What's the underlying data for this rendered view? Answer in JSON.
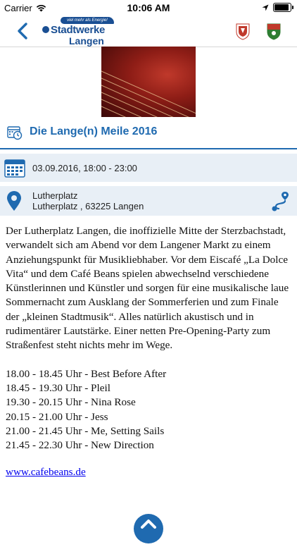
{
  "status_bar": {
    "carrier": "Carrier",
    "time": "10:06 AM"
  },
  "nav": {
    "logo_tagline": "viel mehr als Energie!",
    "logo_line1": "Stadtwerke",
    "logo_line2": "Langen"
  },
  "event": {
    "title": "Die Lange(n) Meile 2016",
    "datetime": "03.09.2016, 18:00 - 23:00",
    "location_name": "Lutherplatz",
    "location_address": "Lutherplatz , 63225 Langen"
  },
  "description": "Der Lutherplatz Langen, die inoffizielle Mitte der Sterzbachstadt, verwandelt sich am Abend vor dem Langener Markt zu einem Anziehungspunkt für Musikliebhaber. Vor dem Eiscafé „La Dolce Vita“ und dem Café Beans spielen abwechselnd verschiedene Künstlerinnen und Künstler und sorgen für eine musikalische laue Sommernacht zum Ausklang der Sommerferien und zum Finale der „kleinen Stadtmusik“. Alles natürlich akustisch und in rudimentärer Lautstärke. Einer netten Pre-Opening-Party zum Straßenfest steht nichts mehr im Wege.",
  "schedule": [
    "18.00 - 18.45 Uhr - Best Before After",
    "18.45 - 19.30 Uhr - Pleil",
    "19.30 - 20.15 Uhr - Nina Rose",
    "20.15 - 21.00 Uhr - Jess",
    "21.00 - 21.45 Uhr - Me, Setting Sails",
    "21.45 - 22.30 Uhr - New Direction"
  ],
  "link_text": "www.cafebeans.de",
  "colors": {
    "accent": "#1f6ab0",
    "brand": "#1a4f93",
    "info_bg": "#e8eff6"
  },
  "icons": [
    "wifi-icon",
    "location-arrow-icon",
    "battery-icon",
    "back-chevron-icon",
    "crest-icon",
    "calendar-clock-icon",
    "calendar-icon",
    "map-pin-icon",
    "route-icon",
    "chevron-up-icon"
  ]
}
